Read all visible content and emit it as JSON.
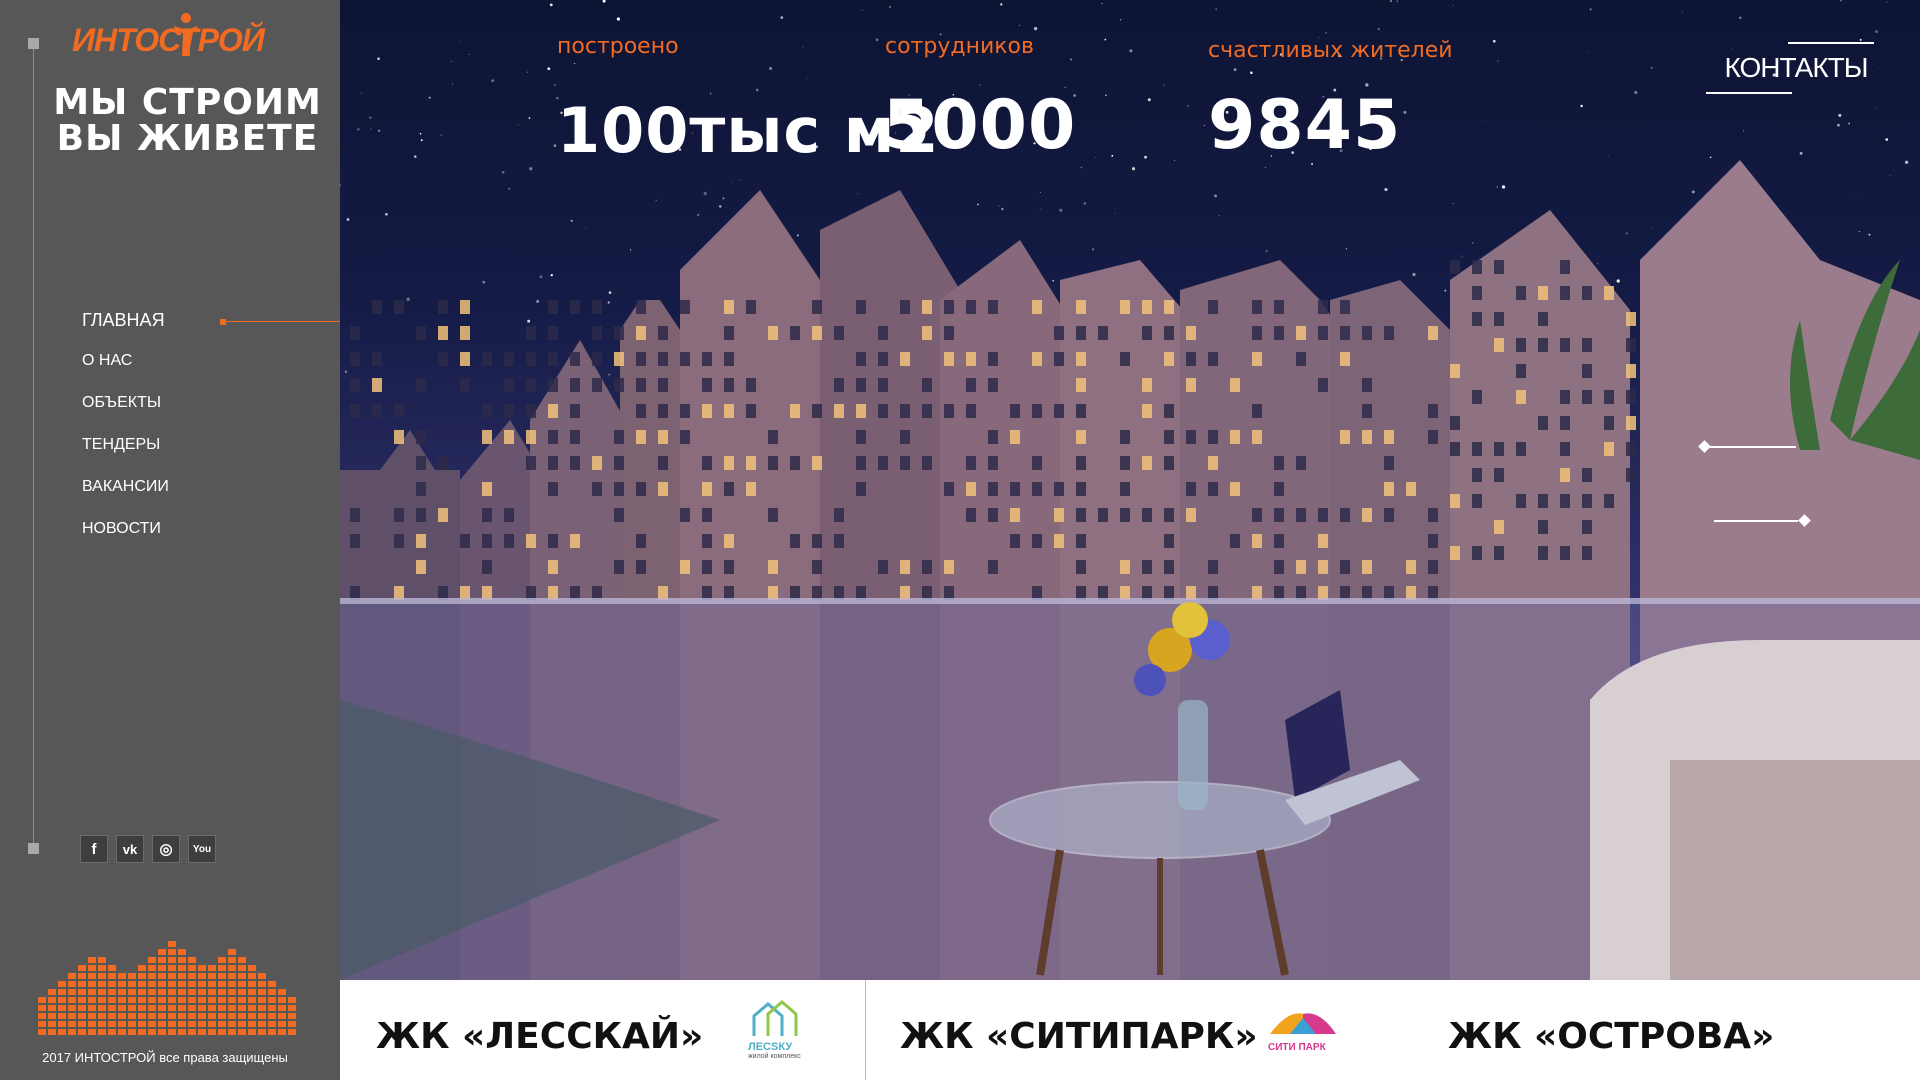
{
  "brand": {
    "logo_text": "ИНТОСТРОЙ",
    "slogan_line1": "МЫ СТРОИМ",
    "slogan_line2": "ВЫ ЖИВЕТЕ",
    "accent_color": "#f26b22"
  },
  "nav": {
    "items": [
      {
        "label": "ГЛАВНАЯ",
        "active": true
      },
      {
        "label": "О НАС"
      },
      {
        "label": "ОБЪЕКТЫ"
      },
      {
        "label": "ТЕНДЕРЫ"
      },
      {
        "label": "ВАКАНСИИ"
      },
      {
        "label": "НОВОСТИ"
      }
    ]
  },
  "socials": [
    {
      "name": "facebook-icon",
      "glyph": "f"
    },
    {
      "name": "vk-icon",
      "glyph": "vk"
    },
    {
      "name": "instagram-icon",
      "glyph": "◎"
    },
    {
      "name": "youtube-icon",
      "glyph": "You"
    }
  ],
  "footer": {
    "copyright": "2017 ИНТОСТРОЙ все права защищены"
  },
  "stats": [
    {
      "label": "построено",
      "value": "100тыс м2"
    },
    {
      "label": "сотрудников",
      "value": "5000"
    },
    {
      "label": "счастливых жителей",
      "value": "9845"
    }
  ],
  "header": {
    "contacts_label": "КОНТАКТЫ"
  },
  "projects": [
    {
      "name": "ЖК «ЛЕССКАЙ»",
      "logo_text": "ЛЕСSКУ",
      "logo_sub": "жилой комплекс"
    },
    {
      "name": "ЖК «СИТИПАРК»",
      "logo_text": "СИТИ ПАРК"
    },
    {
      "name": "ЖК «ОСТРОВА»"
    }
  ]
}
